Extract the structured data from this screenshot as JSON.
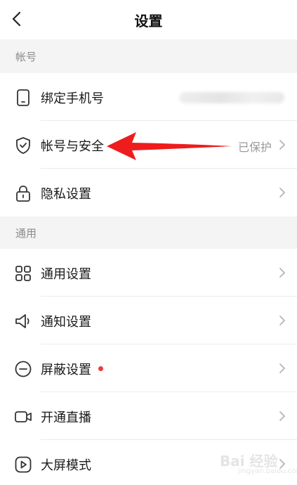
{
  "header": {
    "title": "设置",
    "back_icon": "chevron-left-icon"
  },
  "sections": {
    "account": {
      "label": "帐号"
    },
    "general": {
      "label": "通用"
    }
  },
  "rows": {
    "bind_phone": {
      "label": "绑定手机号",
      "icon": "phone-icon"
    },
    "account_security": {
      "label": "帐号与安全",
      "status": "已保护",
      "icon": "shield-check-icon"
    },
    "privacy": {
      "label": "隐私设置",
      "icon": "lock-icon"
    },
    "general_settings": {
      "label": "通用设置",
      "icon": "grid-icon"
    },
    "notifications": {
      "label": "通知设置",
      "icon": "speaker-icon"
    },
    "block": {
      "label": "屏蔽设置",
      "icon": "minus-circle-icon",
      "has_badge": true
    },
    "live": {
      "label": "开通直播",
      "icon": "video-camera-icon"
    },
    "large_screen": {
      "label": "大屏模式",
      "icon": "play-circle-icon"
    }
  },
  "annotation": {
    "type": "red-arrow",
    "color": "#ee1c1c"
  },
  "watermark": {
    "text": "Bai 经验",
    "sub": "jingyan.baidu.com"
  },
  "colors": {
    "section_bg": "#f4f4f4",
    "badge": "#f03a3a",
    "arrow": "#ee1c1c"
  }
}
